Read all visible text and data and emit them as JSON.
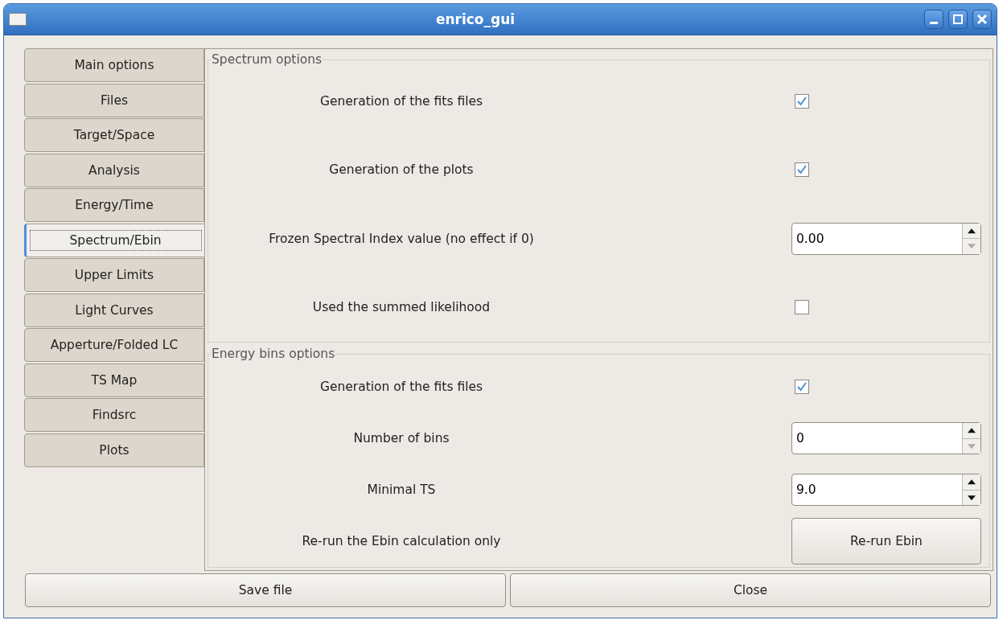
{
  "window": {
    "title": "enrico_gui"
  },
  "tabs": [
    {
      "label": "Main options",
      "selected": false
    },
    {
      "label": "Files",
      "selected": false
    },
    {
      "label": "Target/Space",
      "selected": false
    },
    {
      "label": "Analysis",
      "selected": false
    },
    {
      "label": "Energy/Time",
      "selected": false
    },
    {
      "label": "Spectrum/Ebin",
      "selected": true
    },
    {
      "label": "Upper Limits",
      "selected": false
    },
    {
      "label": "Light Curves",
      "selected": false
    },
    {
      "label": "Apperture/Folded LC",
      "selected": false
    },
    {
      "label": "TS Map",
      "selected": false
    },
    {
      "label": "Findsrc",
      "selected": false
    },
    {
      "label": "Plots",
      "selected": false
    }
  ],
  "groups": [
    {
      "title": "Spectrum options",
      "rows": [
        {
          "kind": "checkbox",
          "label": "Generation of the fits files",
          "checked": true
        },
        {
          "kind": "checkbox",
          "label": "Generation of the plots",
          "checked": true
        },
        {
          "kind": "spin",
          "label": "Frozen Spectral Index value (no effect if 0)",
          "value": "0.00",
          "down_disabled": true
        },
        {
          "kind": "checkbox",
          "label": "Used the summed likelihood",
          "checked": false
        }
      ]
    },
    {
      "title": "Energy bins options",
      "rows": [
        {
          "kind": "checkbox",
          "label": "Generation of the fits files",
          "checked": true
        },
        {
          "kind": "spin",
          "label": "Number of bins",
          "value": "0",
          "down_disabled": true
        },
        {
          "kind": "spin",
          "label": "Minimal TS",
          "value": "9.0",
          "down_disabled": false
        },
        {
          "kind": "button",
          "label": "Re-run the Ebin calculation only",
          "button": "Re-run Ebin"
        }
      ]
    }
  ],
  "buttons": [
    "Save file",
    "Close"
  ]
}
